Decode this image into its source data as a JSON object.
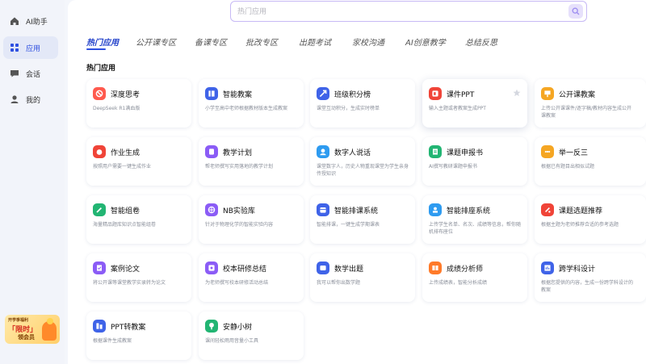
{
  "sidebar": {
    "items": [
      {
        "label": "AI助手",
        "icon": "home-icon"
      },
      {
        "label": "应用",
        "icon": "grid-icon"
      },
      {
        "label": "会话",
        "icon": "chat-icon"
      },
      {
        "label": "我的",
        "icon": "user-icon"
      }
    ],
    "promo": {
      "line1": "开学季福利",
      "line2": "「限时」",
      "line3": "领会员"
    }
  },
  "search": {
    "placeholder": "热门应用"
  },
  "tabs": [
    "热门应用",
    "公开课专区",
    "备课专区",
    "批改专区",
    "出题考试",
    "家校沟通",
    "AI创意教学",
    "总结反思"
  ],
  "section_title": "热门应用",
  "cards": [
    {
      "title": "深度思考",
      "desc": "DeepSeek R1满血版",
      "icon": "brain-icon",
      "color": "#ff5a4e"
    },
    {
      "title": "智能教案",
      "desc": "小学至高中老师根据教材版本生成教案",
      "icon": "book-icon",
      "color": "#3f63e8"
    },
    {
      "title": "班级积分榜",
      "desc": "课堂互动积分，生成实时榜单",
      "icon": "rocket-icon",
      "color": "#3f63e8"
    },
    {
      "title": "课件PPT",
      "desc": "输入主题或者教案生成PPT",
      "icon": "ppt-icon",
      "color": "#f04438"
    },
    {
      "title": "公开课教案",
      "desc": "上传公开课课件/逐字稿/教材内容生成公开课教案",
      "icon": "lecture-icon",
      "color": "#f5a623"
    },
    {
      "title": "作业生成",
      "desc": "按照用户需要一键生成作业",
      "icon": "alarm-icon",
      "color": "#f04438"
    },
    {
      "title": "教学计划",
      "desc": "帮老师撰写实用落地的教学计划",
      "icon": "plan-icon",
      "color": "#8b5cf6"
    },
    {
      "title": "数字人说话",
      "desc": "课堂数字人，历史人物重现课堂为学生亲身传授知识",
      "icon": "avatar-icon",
      "color": "#2e9bf0"
    },
    {
      "title": "课题申报书",
      "desc": "AI撰写教研课题申报书",
      "icon": "report-icon",
      "color": "#22b573"
    },
    {
      "title": "举一反三",
      "desc": "根据已有题目出相似试题",
      "icon": "bulb-icon",
      "color": "#f5a623"
    },
    {
      "title": "智能组卷",
      "desc": "海量精品题库知识点智能组卷",
      "icon": "edit-icon",
      "color": "#22b573"
    },
    {
      "title": "NB实验库",
      "desc": "针对于物理化学的智能实验内容",
      "icon": "flask-icon",
      "color": "#8b5cf6"
    },
    {
      "title": "智能排课系统",
      "desc": "智能排课，一键生成学期课表",
      "icon": "calendar-icon",
      "color": "#3f63e8"
    },
    {
      "title": "智能排座系统",
      "desc": "上传学生名单、名次、成绩等信息，帮你随机排布座位",
      "icon": "seat-icon",
      "color": "#2e9bf0"
    },
    {
      "title": "课题选题推荐",
      "desc": "根据主题为老师推荐合适的参考选题",
      "icon": "topic-icon",
      "color": "#f04438"
    },
    {
      "title": "案例论文",
      "desc": "将公开课等课堂教学实录转为论文",
      "icon": "paper-icon",
      "color": "#8b5cf6"
    },
    {
      "title": "校本研修总结",
      "desc": "为老师撰写校本研修活动总结",
      "icon": "summary-icon",
      "color": "#8b5cf6"
    },
    {
      "title": "数学出题",
      "desc": "我可以帮你出数学题",
      "icon": "math-icon",
      "color": "#3f63e8"
    },
    {
      "title": "成绩分析师",
      "desc": "上传成绩表，智能分析成绩",
      "icon": "chart-icon",
      "color": "#ff7a29"
    },
    {
      "title": "跨学科设计",
      "desc": "根据您提供的内容，生成一份跨学科设计的教案",
      "icon": "cross-icon",
      "color": "#3f63e8"
    },
    {
      "title": "PPT转教案",
      "desc": "根据课件生成教案",
      "icon": "convert-icon",
      "color": "#3f63e8"
    },
    {
      "title": "安静小树",
      "desc": "课间轻松雨用音量小工具",
      "icon": "tree-icon",
      "color": "#22b573"
    }
  ],
  "colors": {
    "accent": "#2e4fe0",
    "search_border": "#c7b9f5",
    "sidebar_bg": "#f2f4fa"
  }
}
